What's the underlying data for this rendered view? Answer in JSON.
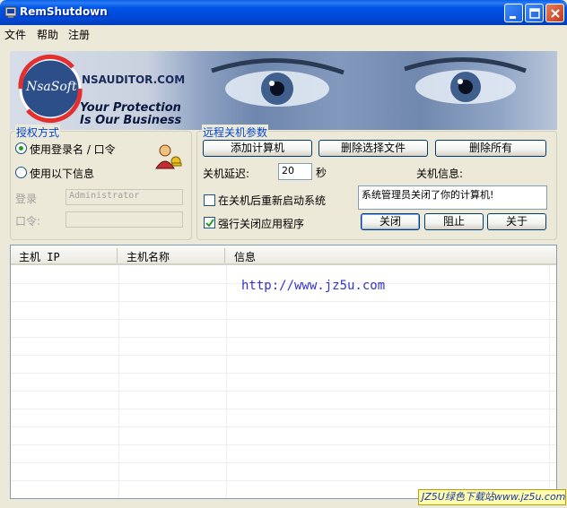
{
  "window": {
    "title": "RemShutdown"
  },
  "menu": [
    "文件",
    "帮助",
    "注册"
  ],
  "banner": {
    "logo_text": "NsaSoft",
    "site": "NSAUDITOR.COM",
    "slogan_line1": "Your Protection",
    "slogan_line2": "Is Our Business"
  },
  "auth": {
    "title": "授权方式",
    "option1": "使用登录名 / 口令",
    "option2": "使用以下信息",
    "login_label": "登录",
    "login_value": "Administrator",
    "password_label": "口令:",
    "password_value": ""
  },
  "remote": {
    "title": "远程关机参数",
    "add_button": "添加计算机",
    "remove_selected_button": "删除选择文件",
    "remove_all_button": "删除所有",
    "delay_label": "关机延迟:",
    "delay_value": "20",
    "delay_unit": "秒",
    "message_label": "关机信息:",
    "message_value": "系统管理员关闭了你的计算机!",
    "restart_label": "在关机后重新启动系统",
    "force_label": "强行关闭应用程序",
    "shutdown_button": "关闭",
    "abort_button": "阻止",
    "about_button": "关于"
  },
  "list": {
    "columns": [
      "主机 IP",
      "主机名称",
      "信息"
    ],
    "url_text": "http://www.jz5u.com"
  },
  "watermark": "JZ5U绿色下载站www.jz5u.com",
  "colors": {
    "titlebar": "#0055e5",
    "group_title": "#0046d5",
    "url": "#3333cc"
  }
}
